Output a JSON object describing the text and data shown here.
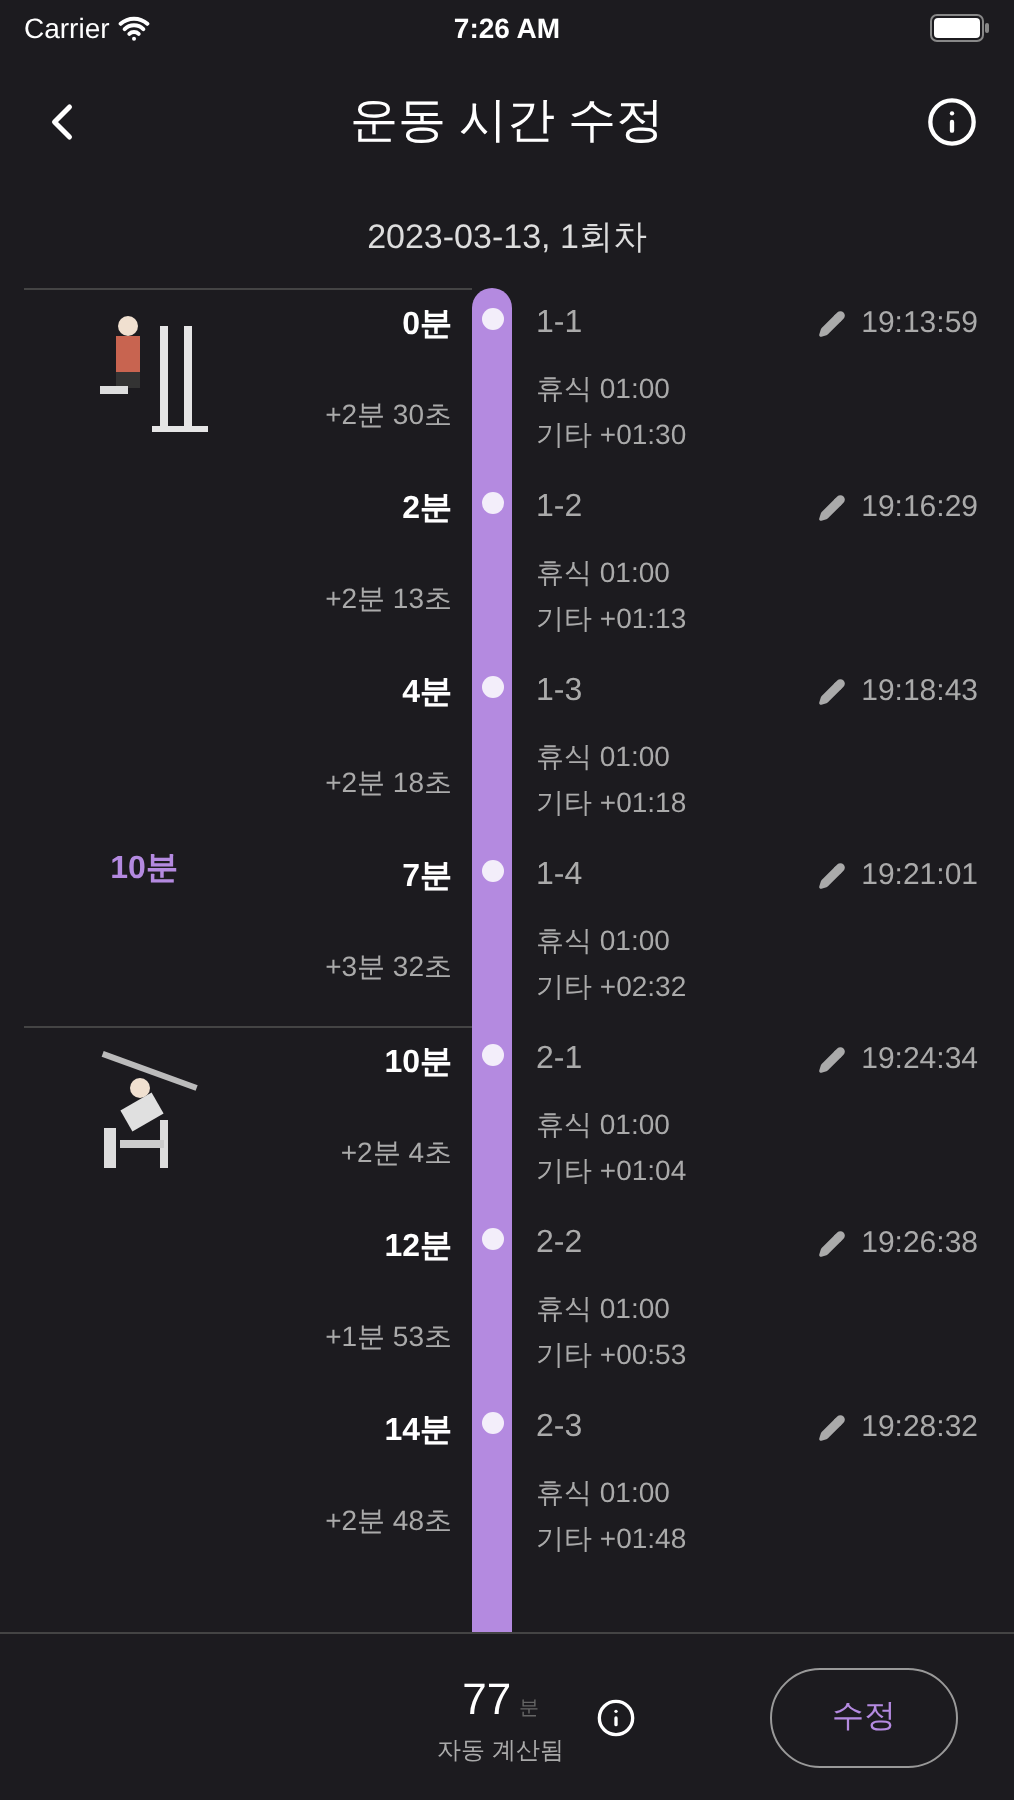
{
  "status_bar": {
    "carrier": "Carrier",
    "time": "7:26 AM"
  },
  "header": {
    "title": "운동 시간 수정"
  },
  "session": "2023-03-13, 1회차",
  "groups": [
    {
      "picture": {
        "kind": "picture"
      },
      "duration": "10분",
      "sets": [
        {
          "elapsed": "0분",
          "delta": "+2분 30초",
          "name": "1-1",
          "rest": "휴식 01:00",
          "other": "기타 +01:30",
          "time": "19:13:59"
        },
        {
          "elapsed": "2분",
          "delta": "+2분 13초",
          "name": "1-2",
          "rest": "휴식 01:00",
          "other": "기타 +01:13",
          "time": "19:16:29"
        },
        {
          "elapsed": "4분",
          "delta": "+2분 18초",
          "name": "1-3",
          "rest": "휴식 01:00",
          "other": "기타 +01:18",
          "time": "19:18:43"
        },
        {
          "elapsed": "7분",
          "delta": "+3분 32초",
          "name": "1-4",
          "rest": "휴식 01:00",
          "other": "기타 +02:32",
          "time": "19:21:01"
        }
      ]
    },
    {
      "picture": {
        "kind": "picture"
      },
      "sets": [
        {
          "elapsed": "10분",
          "delta": "+2분 4초",
          "name": "2-1",
          "rest": "휴식 01:00",
          "other": "기타 +01:04",
          "time": "19:24:34"
        },
        {
          "elapsed": "12분",
          "delta": "+1분 53초",
          "name": "2-2",
          "rest": "휴식 01:00",
          "other": "기타 +00:53",
          "time": "19:26:38"
        },
        {
          "elapsed": "14분",
          "delta": "+2분 48초",
          "name": "2-3",
          "rest": "휴식 01:00",
          "other": "기타 +01:48",
          "time": "19:28:32"
        }
      ]
    }
  ],
  "footer": {
    "total": "77",
    "unit": "분",
    "caption": "자동 계산됨",
    "button": "수정"
  }
}
